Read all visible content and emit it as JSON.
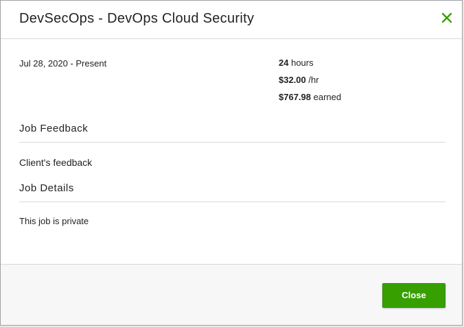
{
  "modal": {
    "title": "DevSecOps - DevOps Cloud Security",
    "close_icon": "close-icon",
    "accent_color": "#37a000"
  },
  "job": {
    "date_range": "Jul 28, 2020 - Present",
    "hours_value": "24",
    "hours_label": "hours",
    "rate_value": "$32.00",
    "rate_label": "/hr",
    "earned_value": "$767.98",
    "earned_label": "earned"
  },
  "feedback": {
    "section_title": "Job Feedback",
    "client_feedback_label": "Client's feedback"
  },
  "details": {
    "section_title": "Job Details",
    "privacy_text": "This job is private"
  },
  "footer": {
    "close_label": "Close"
  }
}
